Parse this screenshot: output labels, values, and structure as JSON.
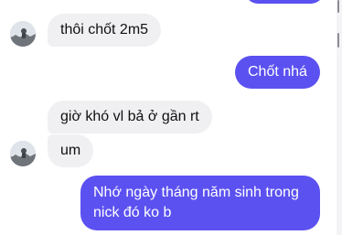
{
  "conversation": {
    "messages": [
      {
        "direction": "incoming",
        "text": "thôi chốt 2m5"
      },
      {
        "direction": "outgoing",
        "text": "Chốt nhá"
      },
      {
        "direction": "incoming",
        "text": "giờ khó vl bả ở gần rt"
      },
      {
        "direction": "incoming",
        "text": "um"
      },
      {
        "direction": "outgoing",
        "text": "Nhớ ngày tháng năm sinh trong nick đó ko b"
      }
    ]
  },
  "colors": {
    "outgoing_bubble": "#5b51f0",
    "incoming_bubble": "#f0f0f2"
  }
}
